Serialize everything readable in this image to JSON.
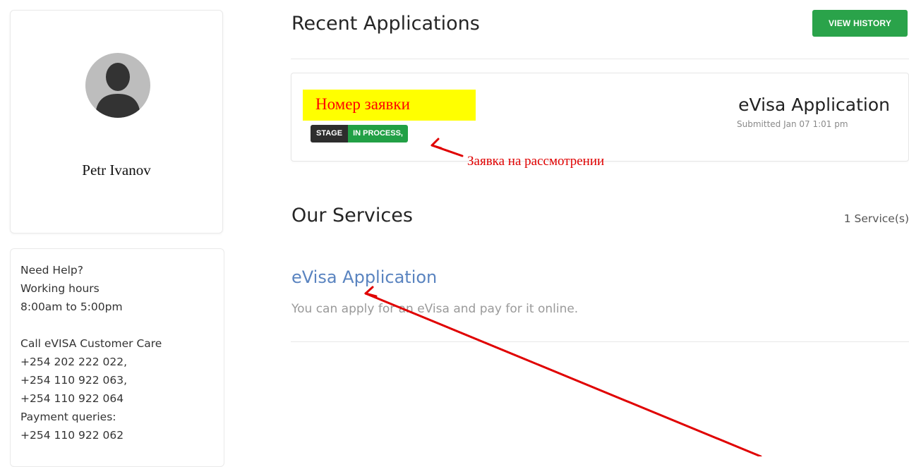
{
  "profile": {
    "name": "Petr Ivanov"
  },
  "help": {
    "lines": [
      "Need Help?",
      "Working hours",
      "8:00am to 5:00pm"
    ],
    "call_lines": [
      "Call eVISA Customer Care",
      "+254 202 222 022,",
      "+254 110 922 063,",
      "+254 110 922 064",
      "Payment queries:",
      "+254 110 922 062"
    ]
  },
  "recent": {
    "title": "Recent Applications",
    "view_history_label": "VIEW HISTORY",
    "application": {
      "number_label": "Номер заявки",
      "stage_label": "STAGE",
      "stage_value": "IN PROCESS,",
      "type": "eVisa Application",
      "submitted": "Submitted Jan 07 1:01 pm"
    },
    "annotation": "Заявка на рассмотрении"
  },
  "services": {
    "title": "Our Services",
    "count": "1 Service(s)",
    "items": [
      {
        "name": "eVisa Application",
        "description": "You can apply for an eVisa and pay for it online."
      }
    ]
  },
  "colors": {
    "accent_green": "#2aa34a",
    "link_blue": "#5a84c0",
    "annotation_red": "#e00000",
    "highlight_yellow": "#ffff00"
  }
}
